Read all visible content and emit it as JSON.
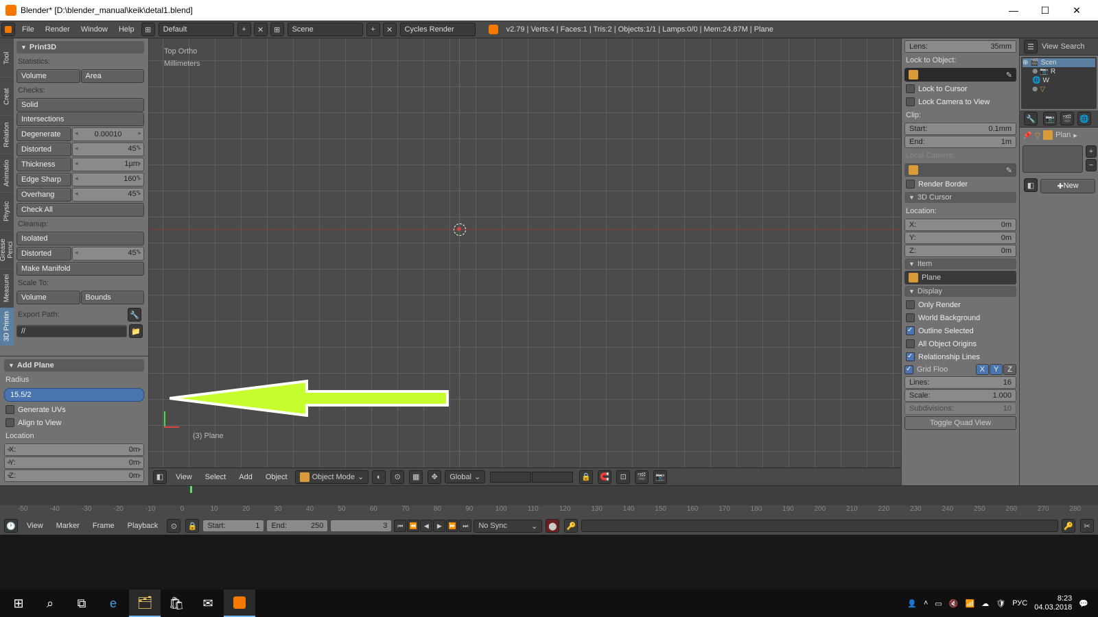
{
  "titlebar": {
    "title": "Blender* [D:\\blender_manual\\keik\\detal1.blend]"
  },
  "menus": {
    "file": "File",
    "render": "Render",
    "window": "Window",
    "help": "Help"
  },
  "layout_selector": "Default",
  "scene_selector": "Scene",
  "engine_selector": "Cycles Render",
  "stats_text": "v2.79 | Verts:4 | Faces:1 | Tris:2 | Objects:1/1 | Lamps:0/0 | Mem:24.87M | Plane",
  "vtabs": [
    "Tool",
    "Creat",
    "Relation",
    "Animatio",
    "Physic",
    "Grease Penci",
    "Measurei",
    "3D Printin"
  ],
  "print3d": {
    "title": "Print3D",
    "stats_hdr": "Statistics:",
    "volume": "Volume",
    "area": "Area",
    "checks_hdr": "Checks:",
    "solid": "Solid",
    "intersections": "Intersections",
    "degen_lbl": "Degenerate",
    "degen_val": "0.00010",
    "distort_lbl": "Distorted",
    "distort_val": "45°",
    "thick_lbl": "Thickness",
    "thick_val": "1µm",
    "edge_lbl": "Edge Sharp",
    "edge_val": "160°",
    "over_lbl": "Overhang",
    "over_val": "45°",
    "checkall": "Check All",
    "cleanup_hdr": "Cleanup:",
    "isolated": "Isolated",
    "distort2_lbl": "Distorted",
    "distort2_val": "45°",
    "manifold": "Make Manifold",
    "scaleto": "Scale To:",
    "volume2": "Volume",
    "bounds": "Bounds",
    "export": "Export Path:",
    "path": "//"
  },
  "addplane": {
    "title": "Add Plane",
    "radius_lbl": "Radius",
    "radius_val": "15.5/2",
    "gen_uvs": "Generate UVs",
    "align": "Align to View",
    "loc_hdr": "Location",
    "x": "X:",
    "y": "Y:",
    "z": "Z:",
    "zero": "0m"
  },
  "viewport": {
    "view_mode": "Top Ortho",
    "units": "Millimeters",
    "obj": "(3) Plane",
    "hdr_view": "View",
    "hdr_select": "Select",
    "hdr_add": "Add",
    "hdr_object": "Object",
    "mode": "Object Mode",
    "orient": "Global"
  },
  "rprops": {
    "lens_lbl": "Lens:",
    "lens_val": "35mm",
    "lock_hdr": "Lock to Object:",
    "lock_cursor": "Lock to Cursor",
    "lock_cam": "Lock Camera to View",
    "clip_hdr": "Clip:",
    "start_lbl": "Start:",
    "start_val": "0.1mm",
    "end_lbl": "End:",
    "end_val": "1m",
    "localcam": "Local Camera:",
    "renderborder": "Render Border",
    "cursor_hdr": "3D Cursor",
    "loc_hdr": "Location:",
    "x": "X:",
    "y": "Y:",
    "z": "Z:",
    "zero": "0m",
    "item_hdr": "Item",
    "item_name": "Plane",
    "disp_hdr": "Display",
    "only_render": "Only Render",
    "world_bg": "World Background",
    "outline": "Outline Selected",
    "all_orig": "All Object Origins",
    "rel_lines": "Relationship Lines",
    "grid_floor": "Grid Floo",
    "gx": "X",
    "gy": "Y",
    "gz": "Z",
    "lines_lbl": "Lines:",
    "lines_val": "16",
    "scale_lbl": "Scale:",
    "scale_val": "1.000",
    "subdiv_lbl": "Subdivisions:",
    "subdiv_val": "10",
    "quad": "Toggle Quad View"
  },
  "outliner": {
    "view": "View",
    "search": "Search",
    "scene": "Scen",
    "r": "R",
    "w": "W",
    "plan": "Plan",
    "new": "New"
  },
  "timeline": {
    "ticks": [
      "-50",
      "-40",
      "-30",
      "-20",
      "-10",
      "0",
      "10",
      "20",
      "30",
      "40",
      "50",
      "60",
      "70",
      "80",
      "90",
      "100",
      "110",
      "120",
      "130",
      "140",
      "150",
      "160",
      "170",
      "180",
      "190",
      "200",
      "210",
      "220",
      "230",
      "240",
      "250",
      "260",
      "270",
      "280"
    ],
    "view": "View",
    "marker": "Marker",
    "frame": "Frame",
    "playback": "Playback",
    "start_lbl": "Start:",
    "start_val": "1",
    "end_lbl": "End:",
    "end_val": "250",
    "cur_val": "3",
    "sync": "No Sync"
  },
  "tray": {
    "lang": "РУС",
    "time": "8:23",
    "date": "04.03.2018"
  }
}
